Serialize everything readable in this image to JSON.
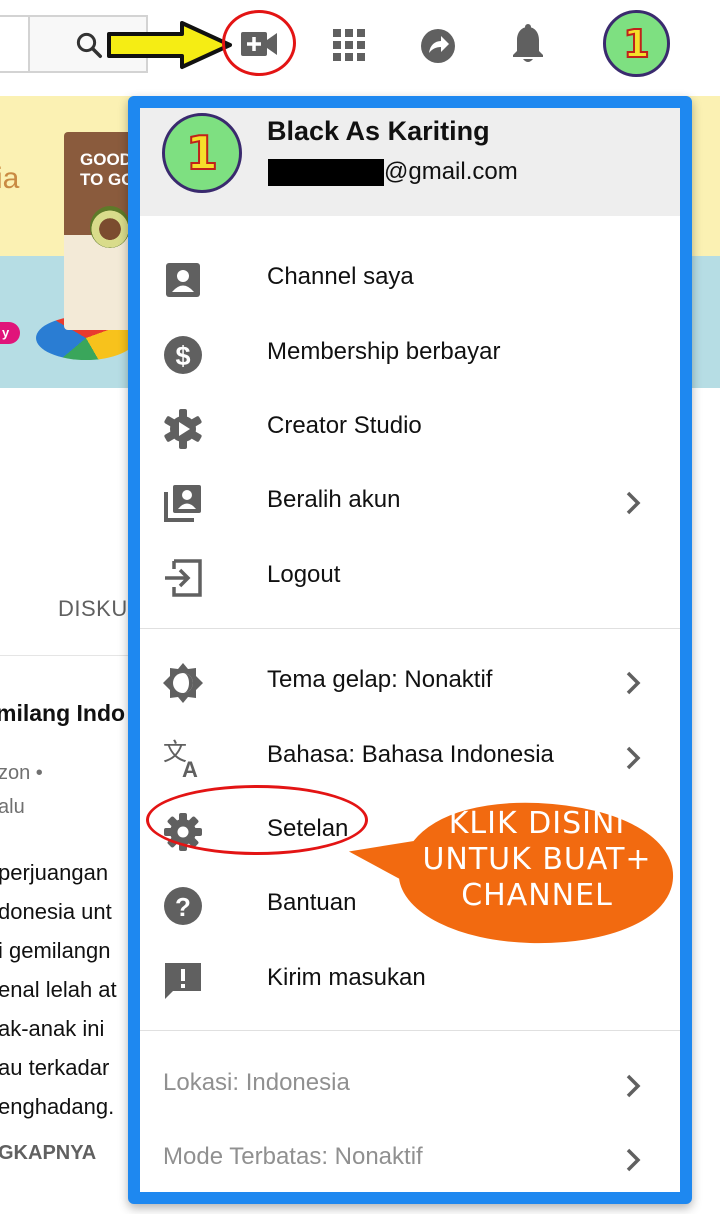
{
  "topbar": {
    "icons": [
      "search-icon",
      "video-upload-icon",
      "apps-grid-icon",
      "share-icon",
      "notifications-bell-icon"
    ],
    "avatar_number": "1"
  },
  "annotation": {
    "arrow_color": "#f5ed14",
    "circle_color": "#e31414",
    "callout_color": "#f26a10",
    "callout_lines": [
      "KLIK DISINI",
      "UNTUK BUAT+",
      "CHANNEL"
    ]
  },
  "background_page": {
    "banner_text": "ia",
    "product_label": "GOOD TO GO",
    "tab_label": "DISKU",
    "video_title": "milang Indo",
    "meta_line1": "zon •",
    "meta_line2": "alu",
    "description_lines": [
      "perjuangan",
      "donesia unt",
      "i gemilangn",
      "enal lelah at",
      "ak-anak ini",
      "au terkadar",
      "enghadang."
    ],
    "more_label": "GKAPNYA"
  },
  "menu": {
    "accent_color": "#1e88f0",
    "user_name": "Black As Kariting",
    "email_suffix": "@gmail.com",
    "avatar_number": "1",
    "section1": [
      {
        "label": "Channel saya",
        "icon": "account-box-icon"
      },
      {
        "label": "Membership berbayar",
        "icon": "dollar-circle-icon"
      },
      {
        "label": "Creator Studio",
        "icon": "gear-play-icon"
      },
      {
        "label": "Beralih akun",
        "icon": "switch-account-icon"
      },
      {
        "label": "Logout",
        "icon": "logout-icon"
      }
    ],
    "section2": [
      {
        "label": "Tema gelap: Nonaktif",
        "icon": "dark-theme-icon"
      },
      {
        "label": "Bahasa: Bahasa Indonesia",
        "icon": "translate-icon"
      },
      {
        "label": "Setelan",
        "icon": "gear-icon"
      },
      {
        "label": "Bantuan",
        "icon": "help-icon"
      },
      {
        "label": "Kirim masukan",
        "icon": "feedback-icon"
      }
    ],
    "section3": [
      {
        "label": "Lokasi: Indonesia"
      },
      {
        "label": "Mode Terbatas: Nonaktif"
      }
    ]
  }
}
